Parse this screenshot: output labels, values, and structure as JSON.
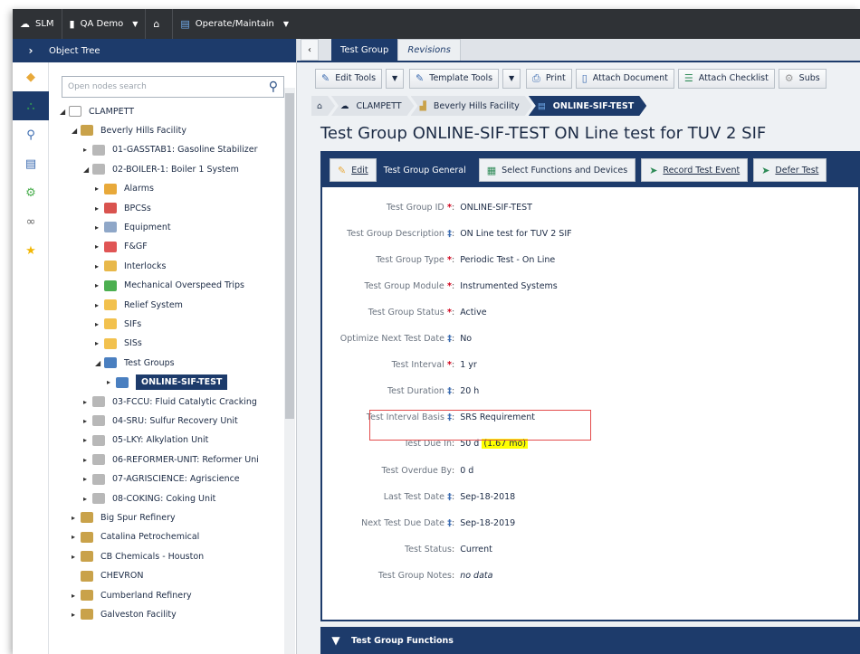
{
  "topbar": {
    "items": [
      {
        "label": "SLM",
        "icon": "cloud-icon"
      },
      {
        "label": "QA Demo",
        "icon": "database-icon"
      },
      {
        "label": "",
        "icon": "home-icon"
      },
      {
        "label": "Operate/Maintain",
        "icon": "document-icon"
      }
    ]
  },
  "left": {
    "header": "Object Tree",
    "search_placeholder": "Open nodes search",
    "tree": [
      {
        "label": "CLAMPETT",
        "level": 0,
        "toggle": "◢",
        "color": "#ffffff"
      },
      {
        "label": "Beverly Hills Facility",
        "level": 1,
        "toggle": "◢",
        "color": "#c9a24a"
      },
      {
        "label": "01-GASSTAB1: Gasoline Stabilizer",
        "level": 2,
        "toggle": "▸",
        "color": "#b8b8b8"
      },
      {
        "label": "02-BOILER-1: Boiler 1 System",
        "level": 2,
        "toggle": "◢",
        "color": "#b8b8b8"
      },
      {
        "label": "Alarms",
        "level": 3,
        "toggle": "▸",
        "color": "#e8a93a"
      },
      {
        "label": "BPCSs",
        "level": 3,
        "toggle": "▸",
        "color": "#d9534f"
      },
      {
        "label": "Equipment",
        "level": 3,
        "toggle": "▸",
        "color": "#8fa7c8"
      },
      {
        "label": "F&GF",
        "level": 3,
        "toggle": "▸",
        "color": "#e05555"
      },
      {
        "label": "Interlocks",
        "level": 3,
        "toggle": "▸",
        "color": "#e8b84a"
      },
      {
        "label": "Mechanical Overspeed Trips",
        "level": 3,
        "toggle": "▸",
        "color": "#4caf50"
      },
      {
        "label": "Relief System",
        "level": 3,
        "toggle": "▸",
        "color": "#f2c14e"
      },
      {
        "label": "SIFs",
        "level": 3,
        "toggle": "▸",
        "color": "#f2c14e"
      },
      {
        "label": "SISs",
        "level": 3,
        "toggle": "▸",
        "color": "#f2c14e"
      },
      {
        "label": "Test Groups",
        "level": 3,
        "toggle": "◢",
        "color": "#4a7fc0"
      },
      {
        "label": "ONLINE-SIF-TEST",
        "level": 4,
        "toggle": "▸",
        "color": "#4a7fc0",
        "selected": true
      },
      {
        "label": "03-FCCU: Fluid Catalytic Cracking",
        "level": 2,
        "toggle": "▸",
        "color": "#b8b8b8"
      },
      {
        "label": "04-SRU: Sulfur Recovery Unit",
        "level": 2,
        "toggle": "▸",
        "color": "#b8b8b8"
      },
      {
        "label": "05-LKY: Alkylation Unit",
        "level": 2,
        "toggle": "▸",
        "color": "#b8b8b8"
      },
      {
        "label": "06-REFORMER-UNIT: Reformer Uni",
        "level": 2,
        "toggle": "▸",
        "color": "#b8b8b8"
      },
      {
        "label": "07-AGRISCIENCE: Agriscience",
        "level": 2,
        "toggle": "▸",
        "color": "#b8b8b8"
      },
      {
        "label": "08-COKING: Coking Unit",
        "level": 2,
        "toggle": "▸",
        "color": "#b8b8b8"
      },
      {
        "label": "Big Spur Refinery",
        "level": 1,
        "toggle": "▸",
        "color": "#c9a24a"
      },
      {
        "label": "Catalina Petrochemical",
        "level": 1,
        "toggle": "▸",
        "color": "#c9a24a"
      },
      {
        "label": "CB Chemicals - Houston",
        "level": 1,
        "toggle": "▸",
        "color": "#c9a24a"
      },
      {
        "label": "CHEVRON",
        "level": 1,
        "toggle": "",
        "color": "#c9a24a"
      },
      {
        "label": "Cumberland Refinery",
        "level": 1,
        "toggle": "▸",
        "color": "#c9a24a"
      },
      {
        "label": "Galveston Facility",
        "level": 1,
        "toggle": "▸",
        "color": "#c9a24a"
      }
    ]
  },
  "tabs": {
    "active": "Test Group",
    "inactive": "Revisions"
  },
  "toolbar": {
    "edit_tools": "Edit Tools",
    "template_tools": "Template Tools",
    "print": "Print",
    "attach_document": "Attach Document",
    "attach_checklist": "Attach Checklist",
    "subs": "Subs"
  },
  "breadcrumb": {
    "home": "⌂",
    "b1": "CLAMPETT",
    "b2": "Beverly Hills Facility",
    "b3": "ONLINE-SIF-TEST"
  },
  "page": {
    "title": "Test Group ONLINE-SIF-TEST ON Line test for TUV 2 SIF"
  },
  "card": {
    "edit_label": "Edit",
    "section_title": "Test Group General",
    "select_functions": "Select Functions and Devices",
    "record_test": "Record Test Event",
    "defer_test": "Defer Test"
  },
  "fields": [
    {
      "label": "Test Group ID",
      "marker": "*",
      "value": "ONLINE-SIF-TEST"
    },
    {
      "label": "Test Group Description",
      "marker": "‡",
      "value": "ON Line test for TUV 2 SIF"
    },
    {
      "label": "Test Group Type",
      "marker": "*",
      "value": "Periodic Test - On Line"
    },
    {
      "label": "Test Group Module",
      "marker": "*",
      "value": "Instrumented Systems"
    },
    {
      "label": "Test Group Status",
      "marker": "*",
      "value": "Active"
    },
    {
      "label": "Optimize Next Test Date",
      "marker": "‡",
      "value": "No"
    },
    {
      "label": "Test Interval",
      "marker": "*",
      "value": "1 yr"
    },
    {
      "label": "Test Duration",
      "marker": "‡",
      "value": "20 h"
    },
    {
      "label": "Test Interval Basis",
      "marker": "‡",
      "value": "SRS Requirement"
    },
    {
      "label": "Test Due In",
      "marker": "",
      "value": "50 d",
      "highlight": "(1.67 mo)"
    },
    {
      "label": "Test Overdue By",
      "marker": "",
      "value": "0 d"
    },
    {
      "label": "Last Test Date",
      "marker": "‡",
      "value": "Sep-18-2018"
    },
    {
      "label": "Next Test Due Date",
      "marker": "‡",
      "value": "Sep-18-2019"
    },
    {
      "label": "Test Status",
      "marker": "",
      "value": "Current"
    },
    {
      "label": "Test Group Notes",
      "marker": "",
      "value": "no data",
      "italic": true
    }
  ],
  "bottom": {
    "title": "Test Group Functions"
  }
}
